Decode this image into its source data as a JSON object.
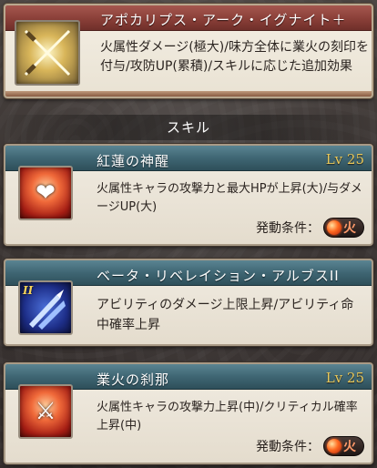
{
  "ougi": {
    "title": "アポカリプス・アーク・イグナイト＋",
    "description": "火属性ダメージ(極大)/味方全体に業火の刻印を付与/攻防UP(累積)/スキルに応じた追加効果",
    "icon": "crossed-blades-icon"
  },
  "section": {
    "label": "スキル"
  },
  "skills": [
    {
      "name": "紅蓮の神醒",
      "level": "Lv 25",
      "description": "火属性キャラの攻撃力と最大HPが上昇(大)/与ダメージUP(大)",
      "trigger_label": "発動条件：",
      "element": "火",
      "icon": "fire-heart-icon"
    },
    {
      "name": "ベータ・リベレイション・アルブスII",
      "level": "",
      "description": "アビリティのダメージ上限上昇/アビリティ命中確率上昇",
      "badge": "II",
      "icon": "blue-arrows-icon"
    },
    {
      "name": "業火の刹那",
      "level": "Lv 25",
      "description": "火属性キャラの攻撃力上昇(中)/クリティカル確率上昇(中)",
      "trigger_label": "発動条件：",
      "element": "火",
      "icon": "fire-blade-icon"
    }
  ],
  "colors": {
    "ougi_header": "#8a3f38",
    "skill_header": "#3f6673",
    "level": "#e8c85a",
    "fire": "#ff6a20"
  }
}
